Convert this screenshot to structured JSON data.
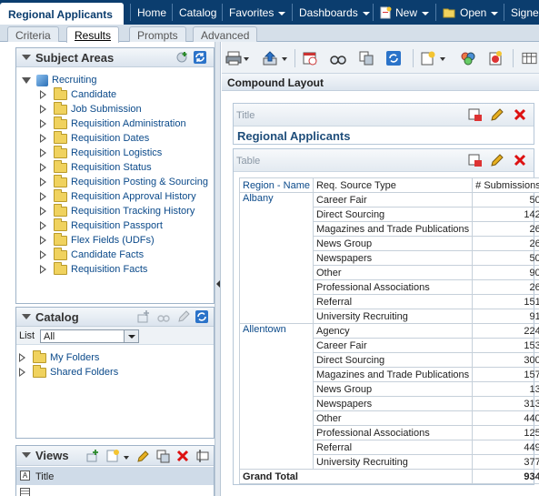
{
  "app": {
    "title": "Regional Applicants"
  },
  "menu": {
    "home": "Home",
    "catalog": "Catalog",
    "favorites": "Favorites",
    "dashboards": "Dashboards",
    "new": "New",
    "open": "Open",
    "signed": "Signed"
  },
  "tabs": [
    {
      "label": "Criteria"
    },
    {
      "label": "Results"
    },
    {
      "label": "Prompts"
    },
    {
      "label": "Advanced"
    }
  ],
  "subject_areas": {
    "title": "Subject Areas",
    "root": "Recruiting",
    "items": [
      "Candidate",
      "Job Submission",
      "Requisition Administration",
      "Requisition Dates",
      "Requisition Logistics",
      "Requisition Status",
      "Requisition Posting & Sourcing",
      "Requisition Approval History",
      "Requisition Tracking History",
      "Requisition Passport",
      "Flex Fields (UDFs)",
      "Candidate Facts",
      "Requisition Facts"
    ]
  },
  "catalog": {
    "title": "Catalog",
    "list_label": "List",
    "list_value": "All",
    "items": [
      "My Folders",
      "Shared Folders"
    ]
  },
  "views": {
    "title": "Views",
    "items": [
      "Title"
    ]
  },
  "layout": {
    "title": "Compound Layout",
    "title_view": {
      "label": "Title",
      "heading": "Regional Applicants"
    },
    "table_view": {
      "label": "Table"
    }
  },
  "table": {
    "headers": {
      "region": "Region - Name",
      "source": "Req. Source Type",
      "submissions": "# Submissions"
    },
    "groups": [
      {
        "region": "Albany",
        "rows": [
          {
            "source": "Career Fair",
            "value": "50"
          },
          {
            "source": "Direct Sourcing",
            "value": "142"
          },
          {
            "source": "Magazines and Trade Publications",
            "value": "26"
          },
          {
            "source": "News Group",
            "value": "26"
          },
          {
            "source": "Newspapers",
            "value": "50"
          },
          {
            "source": "Other",
            "value": "90"
          },
          {
            "source": "Professional Associations",
            "value": "26"
          },
          {
            "source": "Referral",
            "value": "151"
          },
          {
            "source": "University Recruiting",
            "value": "91"
          }
        ]
      },
      {
        "region": "Allentown",
        "rows": [
          {
            "source": "Agency",
            "value": "224"
          },
          {
            "source": "Career Fair",
            "value": "153"
          },
          {
            "source": "Direct Sourcing",
            "value": "300"
          },
          {
            "source": "Magazines and Trade Publications",
            "value": "157"
          },
          {
            "source": "News Group",
            "value": "13"
          },
          {
            "source": "Newspapers",
            "value": "313"
          },
          {
            "source": "Other",
            "value": "440"
          },
          {
            "source": "Professional Associations",
            "value": "125"
          },
          {
            "source": "Referral",
            "value": "449"
          },
          {
            "source": "University Recruiting",
            "value": "377"
          }
        ]
      }
    ],
    "grand_total_label": "Grand Total",
    "grand_total_value": "934"
  }
}
